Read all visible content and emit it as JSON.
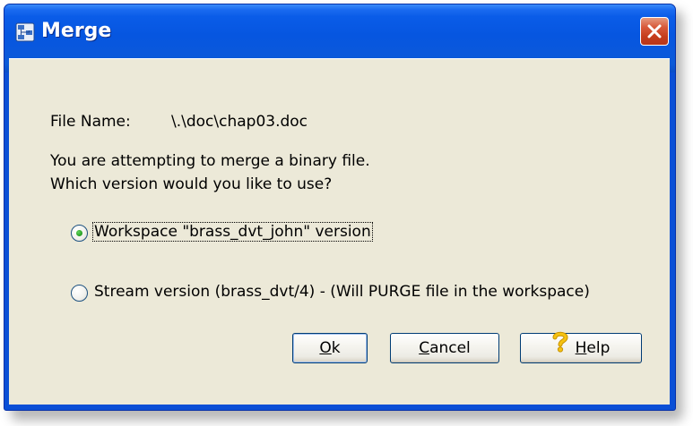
{
  "window": {
    "title": "Merge",
    "close_tooltip": "Close"
  },
  "fields": {
    "file_name_label": "File Name:",
    "file_name_value": "\\.\\doc\\chap03.doc"
  },
  "message": {
    "line1": "You are attempting to merge a binary file.",
    "line2": "Which version would you like to use?"
  },
  "options": [
    {
      "label": "Workspace \"brass_dvt_john\" version",
      "selected": true
    },
    {
      "label": "Stream version (brass_dvt/4) - (Will PURGE file in the workspace)",
      "selected": false
    }
  ],
  "buttons": {
    "ok_mnemonic": "O",
    "ok_rest": "k",
    "cancel_mnemonic": "C",
    "cancel_rest": "ancel",
    "help_mnemonic": "H",
    "help_rest": "elp"
  },
  "colors": {
    "titlebar": "#0a5ce8",
    "dialog_bg": "#ece9d8",
    "close_button": "#c53d1c",
    "radio_selected": "#2fa82c",
    "help_icon": "#f5c211"
  },
  "icons": {
    "app": "merge-app-icon",
    "close": "close-icon",
    "help": "question-mark-icon"
  }
}
